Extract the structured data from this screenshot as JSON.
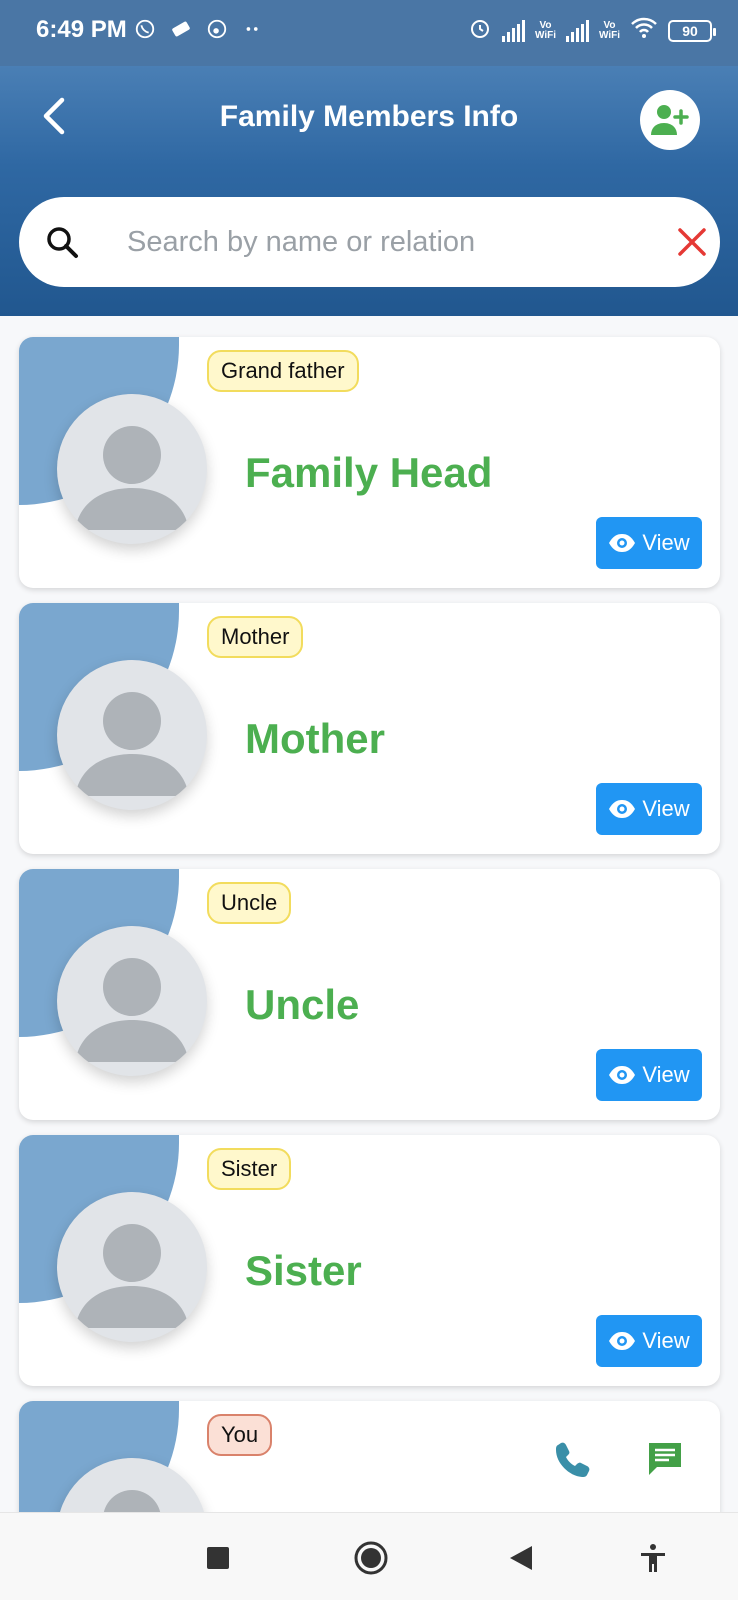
{
  "status_bar": {
    "time": "6:49 PM",
    "battery": "90",
    "vowifi_label": "Vo\nWiFi"
  },
  "header": {
    "title": "Family Members Info",
    "back_icon": "chevron-left-icon",
    "add_icon": "person-add-icon",
    "gradient_top": "#4a7fb5",
    "gradient_bottom": "#21578f"
  },
  "search": {
    "placeholder": "Search by name or relation",
    "value": "",
    "clear_color": "#e53935"
  },
  "members": [
    {
      "relation": "Grand father",
      "name": "Family Head",
      "view_label": "View"
    },
    {
      "relation": "Mother",
      "name": "Mother",
      "view_label": "View"
    },
    {
      "relation": "Uncle",
      "name": "Uncle",
      "view_label": "View"
    },
    {
      "relation": "Sister",
      "name": "Sister",
      "view_label": "View"
    },
    {
      "relation": "You",
      "name": "",
      "view_label": ""
    }
  ],
  "colors": {
    "name_green": "#4caf50",
    "view_blue": "#2196f3",
    "badge_yellow": "#fff8cc",
    "badge_you": "#fbe0d6",
    "call_teal": "#3a8fa8",
    "msg_green": "#43a047"
  },
  "navbar": {
    "icons": [
      "recents-square-icon",
      "home-circle-icon",
      "back-triangle-icon",
      "accessibility-icon"
    ]
  }
}
